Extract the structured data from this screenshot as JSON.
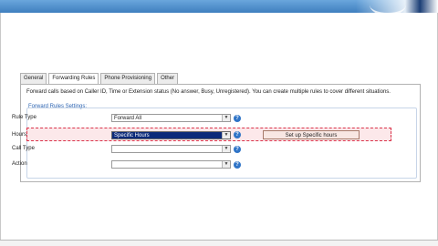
{
  "tabs": [
    {
      "label": "General",
      "active": false
    },
    {
      "label": "Forwarding Rules",
      "active": true
    },
    {
      "label": "Phone Provisioning",
      "active": false
    },
    {
      "label": "Other",
      "active": false
    }
  ],
  "description": "Forward calls based on Caller ID, Time or Extension status (No answer, Busy, Unregistered). You can create multiple rules to cover different situations.",
  "section_title": "Forward Rules Settings:",
  "fields": {
    "rule_type": {
      "label": "Rule Type",
      "value": "Forward All"
    },
    "hours": {
      "label": "Hours",
      "value": "Specific Hours"
    },
    "call_type": {
      "label": "Call Type",
      "value": ""
    },
    "action": {
      "label": "Action",
      "value": ""
    }
  },
  "hours_button_label": "Set up Specific hours",
  "icons": {
    "help": "help-icon",
    "dropdown": "chevron-down-icon"
  },
  "colors": {
    "header": "#3f7fbf",
    "link_title": "#2f66b3",
    "selection": "#0b2a7a",
    "highlight_border": "#d9334a",
    "help_icon": "#2f74c7"
  }
}
